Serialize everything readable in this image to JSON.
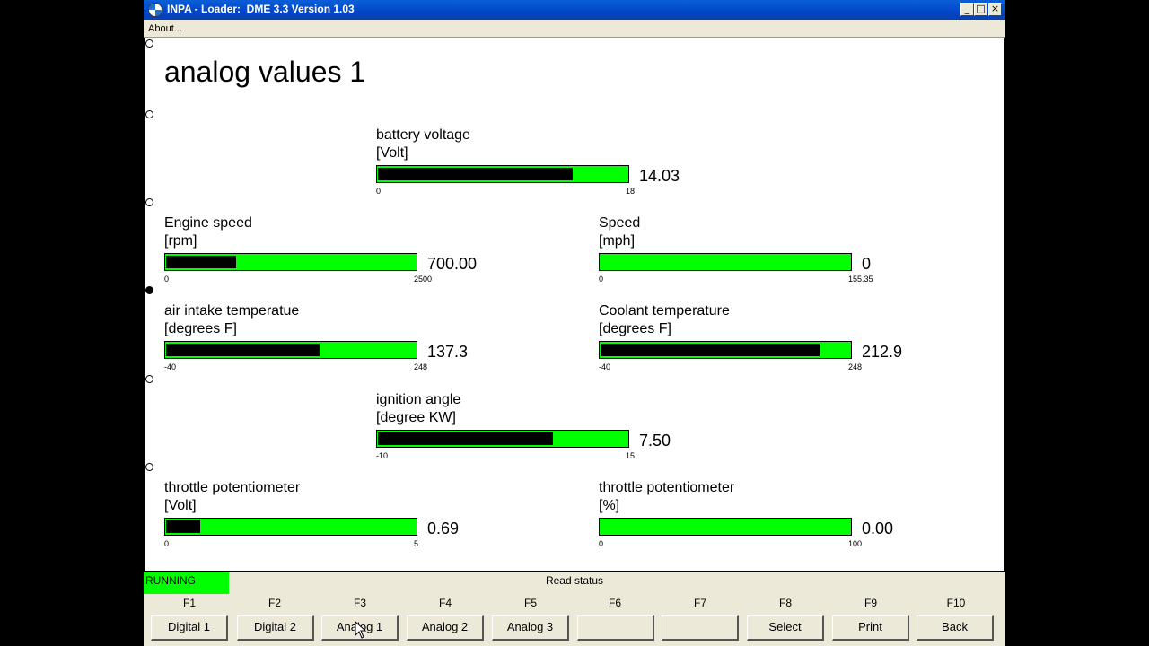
{
  "window": {
    "title": "INPA - Loader:  DME 3.3 Version 1.03",
    "controls": [
      "_",
      "□",
      "×"
    ]
  },
  "menu": {
    "about": "About..."
  },
  "page": {
    "title": "analog values 1"
  },
  "gauges": [
    {
      "label": "battery voltage",
      "unit": "[Volt]",
      "value_text": "14.03",
      "min": "0",
      "max": "18",
      "fill_fraction": 0.78
    },
    {
      "label": "Engine speed",
      "unit": "[rpm]",
      "value_text": "700.00",
      "min": "0",
      "max": "2500",
      "fill_fraction": 0.28
    },
    {
      "label": "Speed",
      "unit": "[mph]",
      "value_text": "0",
      "min": "0",
      "max": "155.35",
      "fill_fraction": 0.0
    },
    {
      "label": "air intake temperatue",
      "unit": "[degrees F]",
      "value_text": "137.3",
      "min": "-40",
      "max": "248",
      "fill_fraction": 0.615
    },
    {
      "label": "Coolant temperature",
      "unit": "[degrees F]",
      "value_text": "212.9",
      "min": "-40",
      "max": "248",
      "fill_fraction": 0.878
    },
    {
      "label": "ignition angle",
      "unit": "[degree KW]",
      "value_text": "7.50",
      "min": "-10",
      "max": "15",
      "fill_fraction": 0.7
    },
    {
      "label": "throttle potentiometer",
      "unit": "[Volt]",
      "value_text": "0.69",
      "min": "0",
      "max": "5",
      "fill_fraction": 0.138
    },
    {
      "label": "throttle potentiometer",
      "unit": "[%]",
      "value_text": "0.00",
      "min": "0",
      "max": "100",
      "fill_fraction": 0.0
    }
  ],
  "status": {
    "running": "RUNNING",
    "read_status": "Read status"
  },
  "fkeys": [
    {
      "key": "F1",
      "label": "Digital 1"
    },
    {
      "key": "F2",
      "label": "Digital 2"
    },
    {
      "key": "F3",
      "label": "Analog 1"
    },
    {
      "key": "F4",
      "label": "Analog 2"
    },
    {
      "key": "F5",
      "label": "Analog 3"
    },
    {
      "key": "F6",
      "label": ""
    },
    {
      "key": "F7",
      "label": ""
    },
    {
      "key": "F8",
      "label": "Select"
    },
    {
      "key": "F9",
      "label": "Print"
    },
    {
      "key": "F10",
      "label": "Back"
    }
  ]
}
